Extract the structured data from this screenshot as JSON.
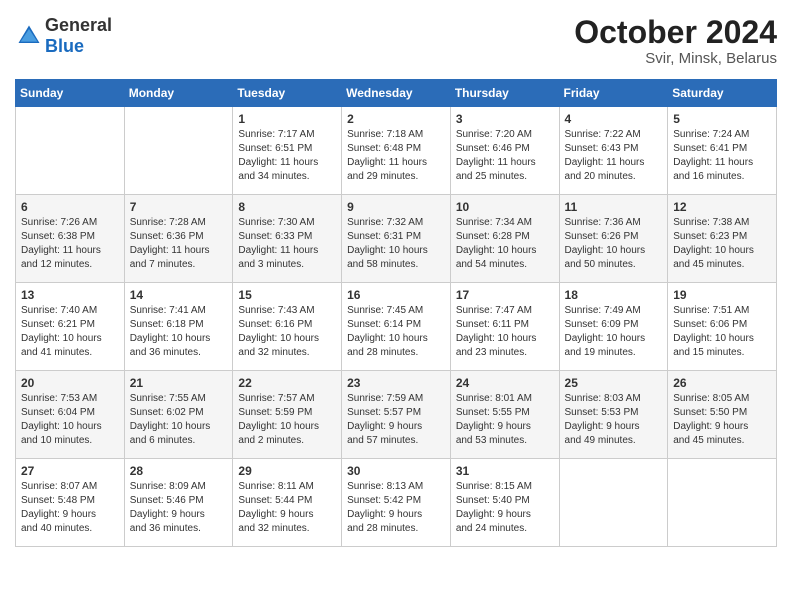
{
  "header": {
    "logo_general": "General",
    "logo_blue": "Blue",
    "month": "October 2024",
    "location": "Svir, Minsk, Belarus"
  },
  "weekdays": [
    "Sunday",
    "Monday",
    "Tuesday",
    "Wednesday",
    "Thursday",
    "Friday",
    "Saturday"
  ],
  "weeks": [
    [
      {
        "day": "",
        "info": ""
      },
      {
        "day": "",
        "info": ""
      },
      {
        "day": "1",
        "info": "Sunrise: 7:17 AM\nSunset: 6:51 PM\nDaylight: 11 hours\nand 34 minutes."
      },
      {
        "day": "2",
        "info": "Sunrise: 7:18 AM\nSunset: 6:48 PM\nDaylight: 11 hours\nand 29 minutes."
      },
      {
        "day": "3",
        "info": "Sunrise: 7:20 AM\nSunset: 6:46 PM\nDaylight: 11 hours\nand 25 minutes."
      },
      {
        "day": "4",
        "info": "Sunrise: 7:22 AM\nSunset: 6:43 PM\nDaylight: 11 hours\nand 20 minutes."
      },
      {
        "day": "5",
        "info": "Sunrise: 7:24 AM\nSunset: 6:41 PM\nDaylight: 11 hours\nand 16 minutes."
      }
    ],
    [
      {
        "day": "6",
        "info": "Sunrise: 7:26 AM\nSunset: 6:38 PM\nDaylight: 11 hours\nand 12 minutes."
      },
      {
        "day": "7",
        "info": "Sunrise: 7:28 AM\nSunset: 6:36 PM\nDaylight: 11 hours\nand 7 minutes."
      },
      {
        "day": "8",
        "info": "Sunrise: 7:30 AM\nSunset: 6:33 PM\nDaylight: 11 hours\nand 3 minutes."
      },
      {
        "day": "9",
        "info": "Sunrise: 7:32 AM\nSunset: 6:31 PM\nDaylight: 10 hours\nand 58 minutes."
      },
      {
        "day": "10",
        "info": "Sunrise: 7:34 AM\nSunset: 6:28 PM\nDaylight: 10 hours\nand 54 minutes."
      },
      {
        "day": "11",
        "info": "Sunrise: 7:36 AM\nSunset: 6:26 PM\nDaylight: 10 hours\nand 50 minutes."
      },
      {
        "day": "12",
        "info": "Sunrise: 7:38 AM\nSunset: 6:23 PM\nDaylight: 10 hours\nand 45 minutes."
      }
    ],
    [
      {
        "day": "13",
        "info": "Sunrise: 7:40 AM\nSunset: 6:21 PM\nDaylight: 10 hours\nand 41 minutes."
      },
      {
        "day": "14",
        "info": "Sunrise: 7:41 AM\nSunset: 6:18 PM\nDaylight: 10 hours\nand 36 minutes."
      },
      {
        "day": "15",
        "info": "Sunrise: 7:43 AM\nSunset: 6:16 PM\nDaylight: 10 hours\nand 32 minutes."
      },
      {
        "day": "16",
        "info": "Sunrise: 7:45 AM\nSunset: 6:14 PM\nDaylight: 10 hours\nand 28 minutes."
      },
      {
        "day": "17",
        "info": "Sunrise: 7:47 AM\nSunset: 6:11 PM\nDaylight: 10 hours\nand 23 minutes."
      },
      {
        "day": "18",
        "info": "Sunrise: 7:49 AM\nSunset: 6:09 PM\nDaylight: 10 hours\nand 19 minutes."
      },
      {
        "day": "19",
        "info": "Sunrise: 7:51 AM\nSunset: 6:06 PM\nDaylight: 10 hours\nand 15 minutes."
      }
    ],
    [
      {
        "day": "20",
        "info": "Sunrise: 7:53 AM\nSunset: 6:04 PM\nDaylight: 10 hours\nand 10 minutes."
      },
      {
        "day": "21",
        "info": "Sunrise: 7:55 AM\nSunset: 6:02 PM\nDaylight: 10 hours\nand 6 minutes."
      },
      {
        "day": "22",
        "info": "Sunrise: 7:57 AM\nSunset: 5:59 PM\nDaylight: 10 hours\nand 2 minutes."
      },
      {
        "day": "23",
        "info": "Sunrise: 7:59 AM\nSunset: 5:57 PM\nDaylight: 9 hours\nand 57 minutes."
      },
      {
        "day": "24",
        "info": "Sunrise: 8:01 AM\nSunset: 5:55 PM\nDaylight: 9 hours\nand 53 minutes."
      },
      {
        "day": "25",
        "info": "Sunrise: 8:03 AM\nSunset: 5:53 PM\nDaylight: 9 hours\nand 49 minutes."
      },
      {
        "day": "26",
        "info": "Sunrise: 8:05 AM\nSunset: 5:50 PM\nDaylight: 9 hours\nand 45 minutes."
      }
    ],
    [
      {
        "day": "27",
        "info": "Sunrise: 8:07 AM\nSunset: 5:48 PM\nDaylight: 9 hours\nand 40 minutes."
      },
      {
        "day": "28",
        "info": "Sunrise: 8:09 AM\nSunset: 5:46 PM\nDaylight: 9 hours\nand 36 minutes."
      },
      {
        "day": "29",
        "info": "Sunrise: 8:11 AM\nSunset: 5:44 PM\nDaylight: 9 hours\nand 32 minutes."
      },
      {
        "day": "30",
        "info": "Sunrise: 8:13 AM\nSunset: 5:42 PM\nDaylight: 9 hours\nand 28 minutes."
      },
      {
        "day": "31",
        "info": "Sunrise: 8:15 AM\nSunset: 5:40 PM\nDaylight: 9 hours\nand 24 minutes."
      },
      {
        "day": "",
        "info": ""
      },
      {
        "day": "",
        "info": ""
      }
    ]
  ]
}
